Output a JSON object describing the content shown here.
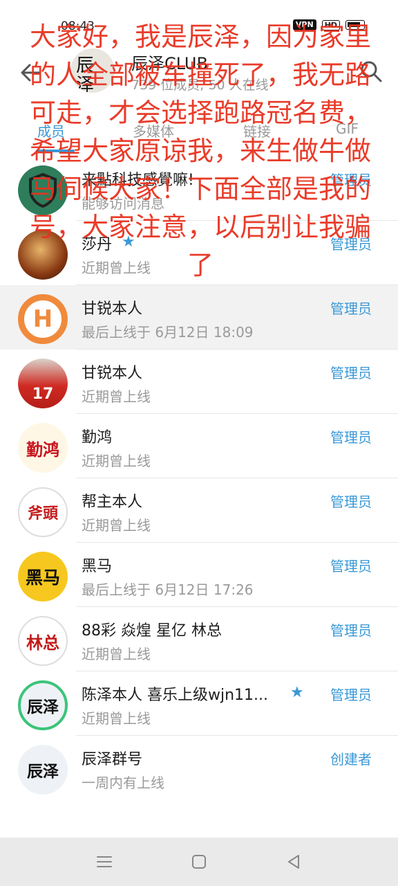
{
  "status_bar": {
    "time": "08:43",
    "vpn": "VPN",
    "hd": "HD"
  },
  "header": {
    "avatar_text": "辰\n泽",
    "title": "辰泽CLUB",
    "subtitle": "739 位成员, 50 人在线"
  },
  "tabs": [
    {
      "label": "成员",
      "active": true
    },
    {
      "label": "多媒体",
      "active": false
    },
    {
      "label": "链接",
      "active": false
    },
    {
      "label": "GIF",
      "active": false
    }
  ],
  "members": [
    {
      "name": "来點科技感覺嘛!",
      "status": "能够访问消息",
      "role": "管理员",
      "avatar": "shield-icon",
      "starred": false,
      "highlight": false
    },
    {
      "name": "莎丹",
      "status": "近期曾上线",
      "role": "管理员",
      "avatar": "photo-portrait",
      "starred": true,
      "highlight": false
    },
    {
      "name": "甘锐本人",
      "status": "最后上线于 6月12日 18:09",
      "role": "管理员",
      "avatar": "hb-logo",
      "starred": false,
      "highlight": true
    },
    {
      "name": "甘锐本人",
      "status": "近期曾上线",
      "role": "管理员",
      "avatar": "photo-football",
      "starred": false,
      "highlight": false
    },
    {
      "name": "勤鸿",
      "status": "近期曾上线",
      "role": "管理员",
      "avatar": "text-qinhong",
      "starred": false,
      "highlight": false
    },
    {
      "name": "帮主本人",
      "status": "近期曾上线",
      "role": "管理员",
      "avatar": "text-futou",
      "starred": false,
      "highlight": false
    },
    {
      "name": "黑马",
      "status": "最后上线于 6月12日 17:26",
      "role": "管理员",
      "avatar": "text-heima",
      "starred": false,
      "highlight": false
    },
    {
      "name": "88彩 焱煌 星亿 林总",
      "status": "近期曾上线",
      "role": "管理员",
      "avatar": "text-linzong",
      "starred": false,
      "highlight": false
    },
    {
      "name": "陈泽本人 喜乐上级wjn11...",
      "status": "近期曾上线",
      "role": "管理员",
      "avatar": "text-chenze",
      "starred": true,
      "highlight": false
    },
    {
      "name": "辰泽群号",
      "status": "一周内有上线",
      "role": "创建者",
      "avatar": "text-chenze",
      "starred": false,
      "highlight": false
    }
  ],
  "overlay_text": "大家好，我是辰泽，因为家里的人全部被车撞死了，我无路可走，才会选择跑路冠名费，希望大家原谅我，来生做牛做马伺候大家！下面全部是我的号，大家注意，以后别让我骗了",
  "avatar_glyphs": {
    "text-qinhong": "勤鸿",
    "text-futou": "斧頭",
    "text-heima": "黑马",
    "text-linzong": "林总",
    "text-chenze": "辰泽",
    "hb-logo": "H"
  },
  "colors": {
    "accent": "#3a98d6",
    "overlay": "#e8321f"
  }
}
